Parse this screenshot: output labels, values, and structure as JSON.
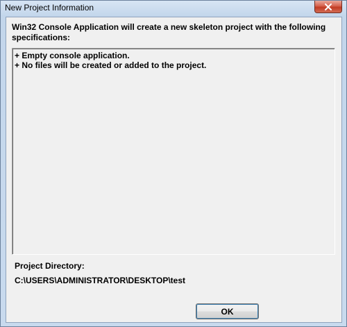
{
  "window": {
    "title": "New Project Information",
    "close_icon": "close-icon"
  },
  "dialog": {
    "heading": "Win32 Console Application will create a new skeleton project with the following specifications:",
    "specs": [
      "+ Empty console application.",
      "+ No files will be created or added to the project."
    ],
    "project_directory_label": "Project Directory:",
    "project_directory_value": "C:\\USERS\\ADMINISTRATOR\\DESKTOP\\test",
    "ok_label": "OK"
  },
  "colors": {
    "close_button": "#c8402a",
    "ok_focus_ring": "#3c7fb1",
    "dialog_background": "#f0f0f0"
  }
}
